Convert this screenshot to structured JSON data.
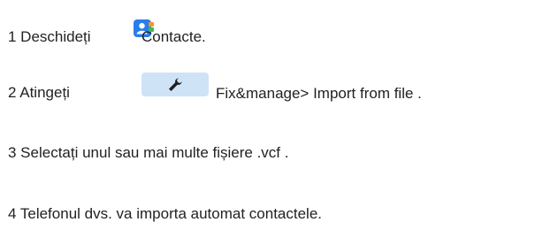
{
  "steps": {
    "s1_before": "1 Deschideți ",
    "s1_after": "Contacte.",
    "s2_before": "2 Atingeți",
    "s2_after": "Fix&manage> Import from file .",
    "s3": "3 Selectați unul sau mai multe fișiere .vcf .",
    "s4": "4 Telefonul dvs. va importa automat contactele."
  },
  "icons": {
    "contacts": "contacts-app-icon",
    "tool": "wrench-icon"
  },
  "colors": {
    "chip_bg": "#cfe3f7",
    "contacts_blue": "#2b7de9",
    "contacts_green": "#3dbb5b",
    "contacts_orange": "#f59a23"
  }
}
